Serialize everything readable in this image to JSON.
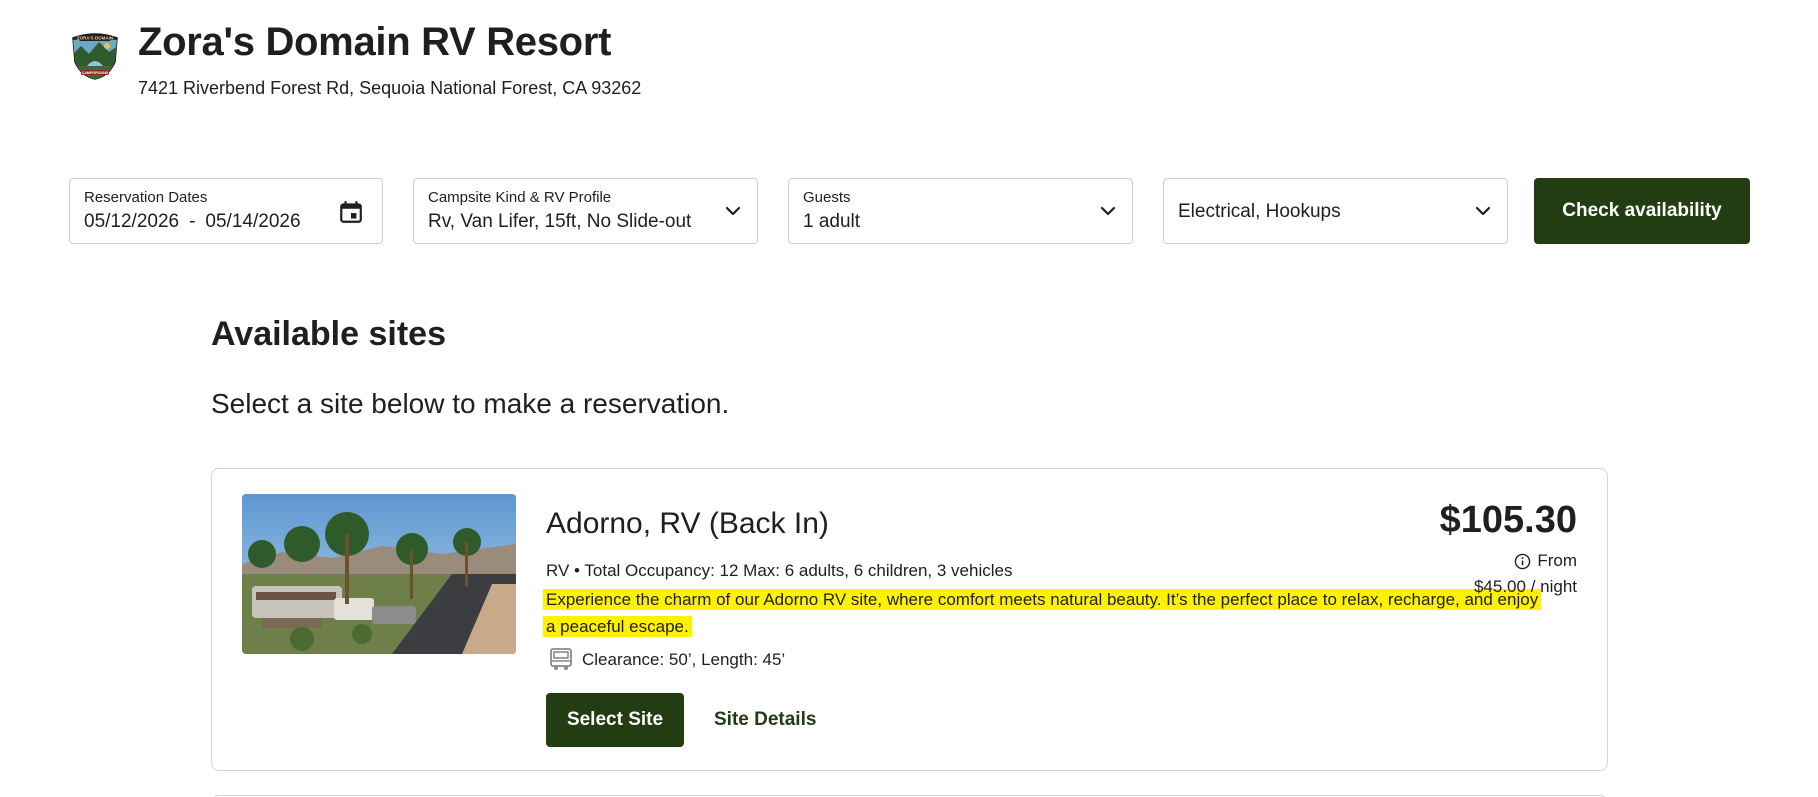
{
  "header": {
    "resort_name": "Zora's Domain RV Resort",
    "address": "7421 Riverbend Forest Rd, Sequoia National Forest, CA 93262",
    "logo_icon": "campground-logo"
  },
  "search": {
    "dates": {
      "label": "Reservation Dates",
      "start": "05/12/2026",
      "separator": "-",
      "end": "05/14/2026",
      "icon": "calendar-icon"
    },
    "campsite": {
      "label": "Campsite Kind & RV Profile",
      "value": "Rv, Van Lifer, 15ft, No Slide-out"
    },
    "guests": {
      "label": "Guests",
      "value": "1 adult"
    },
    "amenities": {
      "value": "Electrical, Hookups"
    },
    "check_label": "Check availability"
  },
  "results": {
    "title": "Available sites",
    "subtitle": "Select a site below to make a reservation.",
    "sites": [
      {
        "name": "Adorno, RV (Back In)",
        "meta": "RV • Total Occupancy: 12 Max: 6 adults, 6 children, 3 vehicles",
        "description": "Experience the charm of our Adorno RV site, where comfort meets natural beauty. It’s the perfect place to relax, recharge, and enjoy a peaceful escape.",
        "dimensions": "Clearance: 50’, Length: 45’",
        "price": "$105.30",
        "from_label": "From",
        "nightly": "$45.00 / night",
        "select_label": "Select Site",
        "details_label": "Site Details"
      }
    ]
  },
  "colors": {
    "brand_green": "#233d12",
    "highlight": "#fff200",
    "border": "#cfcfcf"
  }
}
